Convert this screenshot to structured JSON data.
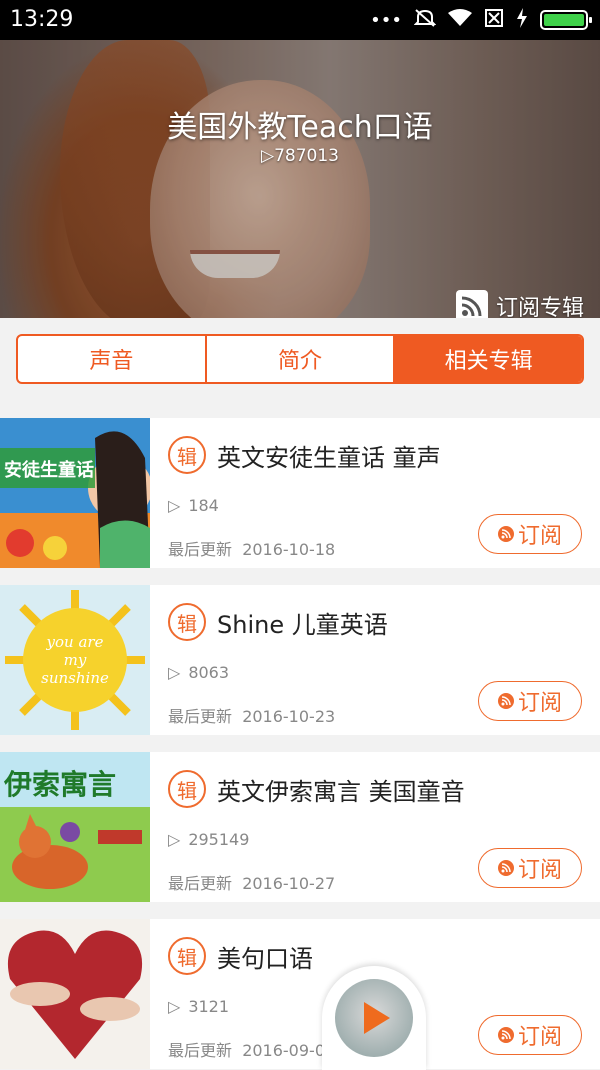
{
  "status_bar": {
    "time": "13:29"
  },
  "hero": {
    "title": "美国外教Teach口语",
    "plays": "787013",
    "subscribe_label": "订阅专辑"
  },
  "tabs": [
    {
      "label": "声音",
      "active": false
    },
    {
      "label": "简介",
      "active": false
    },
    {
      "label": "相关专辑",
      "active": true
    }
  ],
  "albums": [
    {
      "badge": "辑",
      "title": "英文安徒生童话 童声",
      "plays": "184",
      "updated_label": "最后更新",
      "updated_date": "2016-10-18",
      "button": "订阅",
      "thumb_text": "安徒生童话"
    },
    {
      "badge": "辑",
      "title": "Shine 儿童英语",
      "plays": "8063",
      "updated_label": "最后更新",
      "updated_date": "2016-10-23",
      "button": "订阅",
      "thumb_text": "you are my sunshine"
    },
    {
      "badge": "辑",
      "title": "英文伊索寓言 美国童音",
      "plays": "295149",
      "updated_label": "最后更新",
      "updated_date": "2016-10-27",
      "button": "订阅",
      "thumb_text": "伊索寓言"
    },
    {
      "badge": "辑",
      "title": "美句口语",
      "plays": "3121",
      "updated_label": "最后更新",
      "updated_date": "2016-09-06",
      "button": "订阅",
      "thumb_text": ""
    }
  ]
}
